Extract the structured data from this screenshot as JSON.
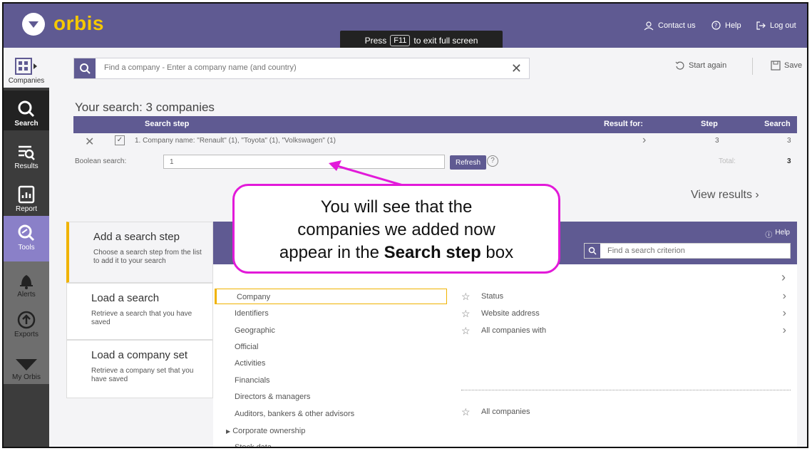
{
  "header": {
    "logo": "orbis",
    "contact": "Contact us",
    "help": "Help",
    "logout": "Log out",
    "fullscreen_prefix": "Press",
    "fullscreen_key": "F11",
    "fullscreen_suffix": "to exit full screen"
  },
  "sidebar": {
    "items": [
      {
        "label": "Companies"
      },
      {
        "label": "Search"
      },
      {
        "label": "Results"
      },
      {
        "label": "Report"
      },
      {
        "label": "Tools"
      },
      {
        "label": "Alerts"
      },
      {
        "label": "Exports"
      },
      {
        "label": "My Orbis"
      }
    ]
  },
  "search": {
    "placeholder": "Find a company - Enter a company name (and country)",
    "start_again": "Start again",
    "save": "Save"
  },
  "summary": {
    "title": "Your search: 3 companies",
    "headers": {
      "step": "Search step",
      "result_for": "Result for:",
      "step_col": "Step",
      "search_col": "Search"
    },
    "row": {
      "text": "1. Company name: \"Renault\" (1), \"Toyota\" (1), \"Volkswagen\" (1)",
      "step": "3",
      "search": "3"
    },
    "boolean_label": "Boolean search:",
    "boolean_value": "1",
    "refresh": "Refresh",
    "total_label": "Total:",
    "total": "3",
    "view_results": "View results"
  },
  "steps": [
    {
      "title": "Add a search step",
      "desc": "Choose a search step from the list to add it to your search"
    },
    {
      "title": "Load a search",
      "desc": "Retrieve a search that you have saved"
    },
    {
      "title": "Load a company set",
      "desc": "Retrieve a company set that you have saved"
    }
  ],
  "panel": {
    "help": "Help",
    "criterion_placeholder": "Find a search criterion"
  },
  "categories": [
    {
      "label": "Company"
    },
    {
      "label": "Identifiers"
    },
    {
      "label": "Geographic"
    },
    {
      "label": "Official"
    },
    {
      "label": "Activities"
    },
    {
      "label": "Financials"
    },
    {
      "label": "Directors & managers"
    },
    {
      "label": "Auditors, bankers & other advisors"
    },
    {
      "label": "Corporate ownership"
    },
    {
      "label": "Stock data"
    }
  ],
  "subitems": [
    {
      "label": "Status"
    },
    {
      "label": "Website address"
    },
    {
      "label": "All companies with"
    },
    {
      "label": "All companies"
    }
  ],
  "callout": {
    "line1": "You will see that the",
    "line2": "companies we added now",
    "line3_prefix": "appear in the",
    "line3_bold": "Search step",
    "line3_suffix": "box"
  },
  "colors": {
    "brand": "#5f5a92",
    "logo": "#f5c800",
    "callout_border": "#e21ad9",
    "selected": "#f0b300"
  }
}
